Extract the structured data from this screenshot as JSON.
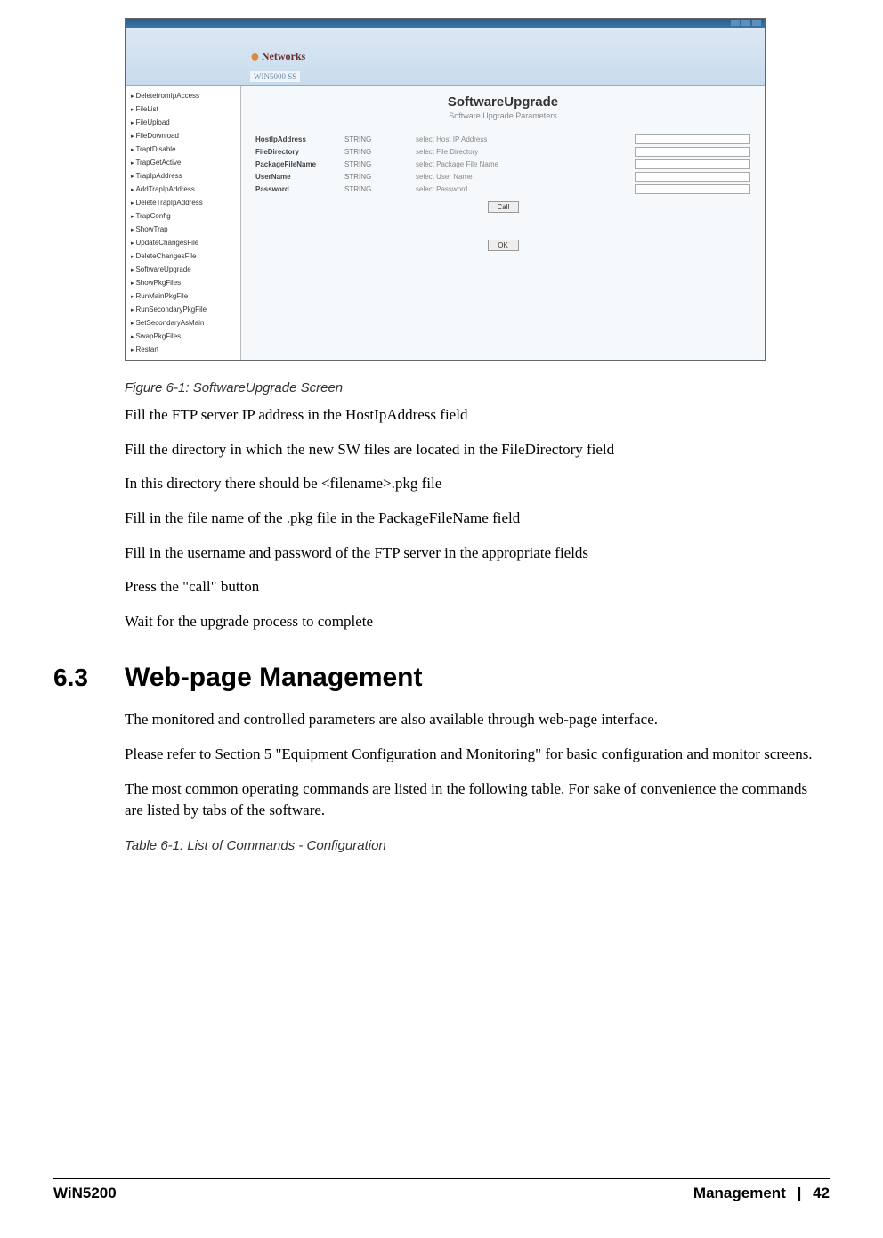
{
  "screenshot": {
    "banner_logo": "Networks",
    "product": "WIN5000 SS",
    "sidebar": [
      "DeletefromIpAccess",
      "FileList",
      "FileUpload",
      "FileDownload",
      "TraptDisable",
      "TrapGetActive",
      "TrapIpAddress",
      "AddTrapIpAddress",
      "DeleteTrapIpAddress",
      "TrapConfig",
      "ShowTrap",
      "UpdateChangesFile",
      "DeleteChangesFile",
      "SoftwareUpgrade",
      "ShowPkgFiles",
      "RunMainPkgFile",
      "RunSecondaryPkgFile",
      "SetSecondaryAsMain",
      "SwapPkgFiles",
      "Restart"
    ],
    "main": {
      "title": "SoftwareUpgrade",
      "subtitle": "Software Upgrade Parameters",
      "rows": [
        {
          "label": "HostIpAddress",
          "type": "STRING",
          "desc": "select Host IP Address"
        },
        {
          "label": "FileDirectory",
          "type": "STRING",
          "desc": "select File Directory"
        },
        {
          "label": "PackageFileName",
          "type": "STRING",
          "desc": "select Package File Name"
        },
        {
          "label": "UserName",
          "type": "STRING",
          "desc": "select User Name"
        },
        {
          "label": "Password",
          "type": "STRING",
          "desc": "select Password"
        }
      ],
      "get_button": "Call",
      "ok_button": "OK"
    }
  },
  "figure_caption": "Figure 6-1: SoftwareUpgrade Screen",
  "paragraphs1": [
    "Fill the FTP server IP address in the HostIpAddress field",
    "Fill the directory in which the new SW files are located in the FileDirectory field",
    "In this directory there should be <filename>.pkg file",
    "Fill in the file name of the .pkg file in the PackageFileName field",
    "Fill in the username and password of the FTP server in the appropriate fields",
    "Press the \"call\" button",
    "Wait for the upgrade process to complete"
  ],
  "section": {
    "number": "6.3",
    "title": "Web-page Management"
  },
  "paragraphs2": [
    "The monitored and controlled parameters are also available through web-page interface.",
    "Please refer to Section 5 \"Equipment Configuration and Monitoring\" for basic configuration and monitor screens.",
    "The most common operating commands are listed in the following table. For sake of convenience the commands are listed by tabs of the software."
  ],
  "table_caption": "Table 6-1: List of Commands - Configuration",
  "footer": {
    "left": "WiN5200",
    "right_label": "Management",
    "sep": "|",
    "page": "42"
  }
}
